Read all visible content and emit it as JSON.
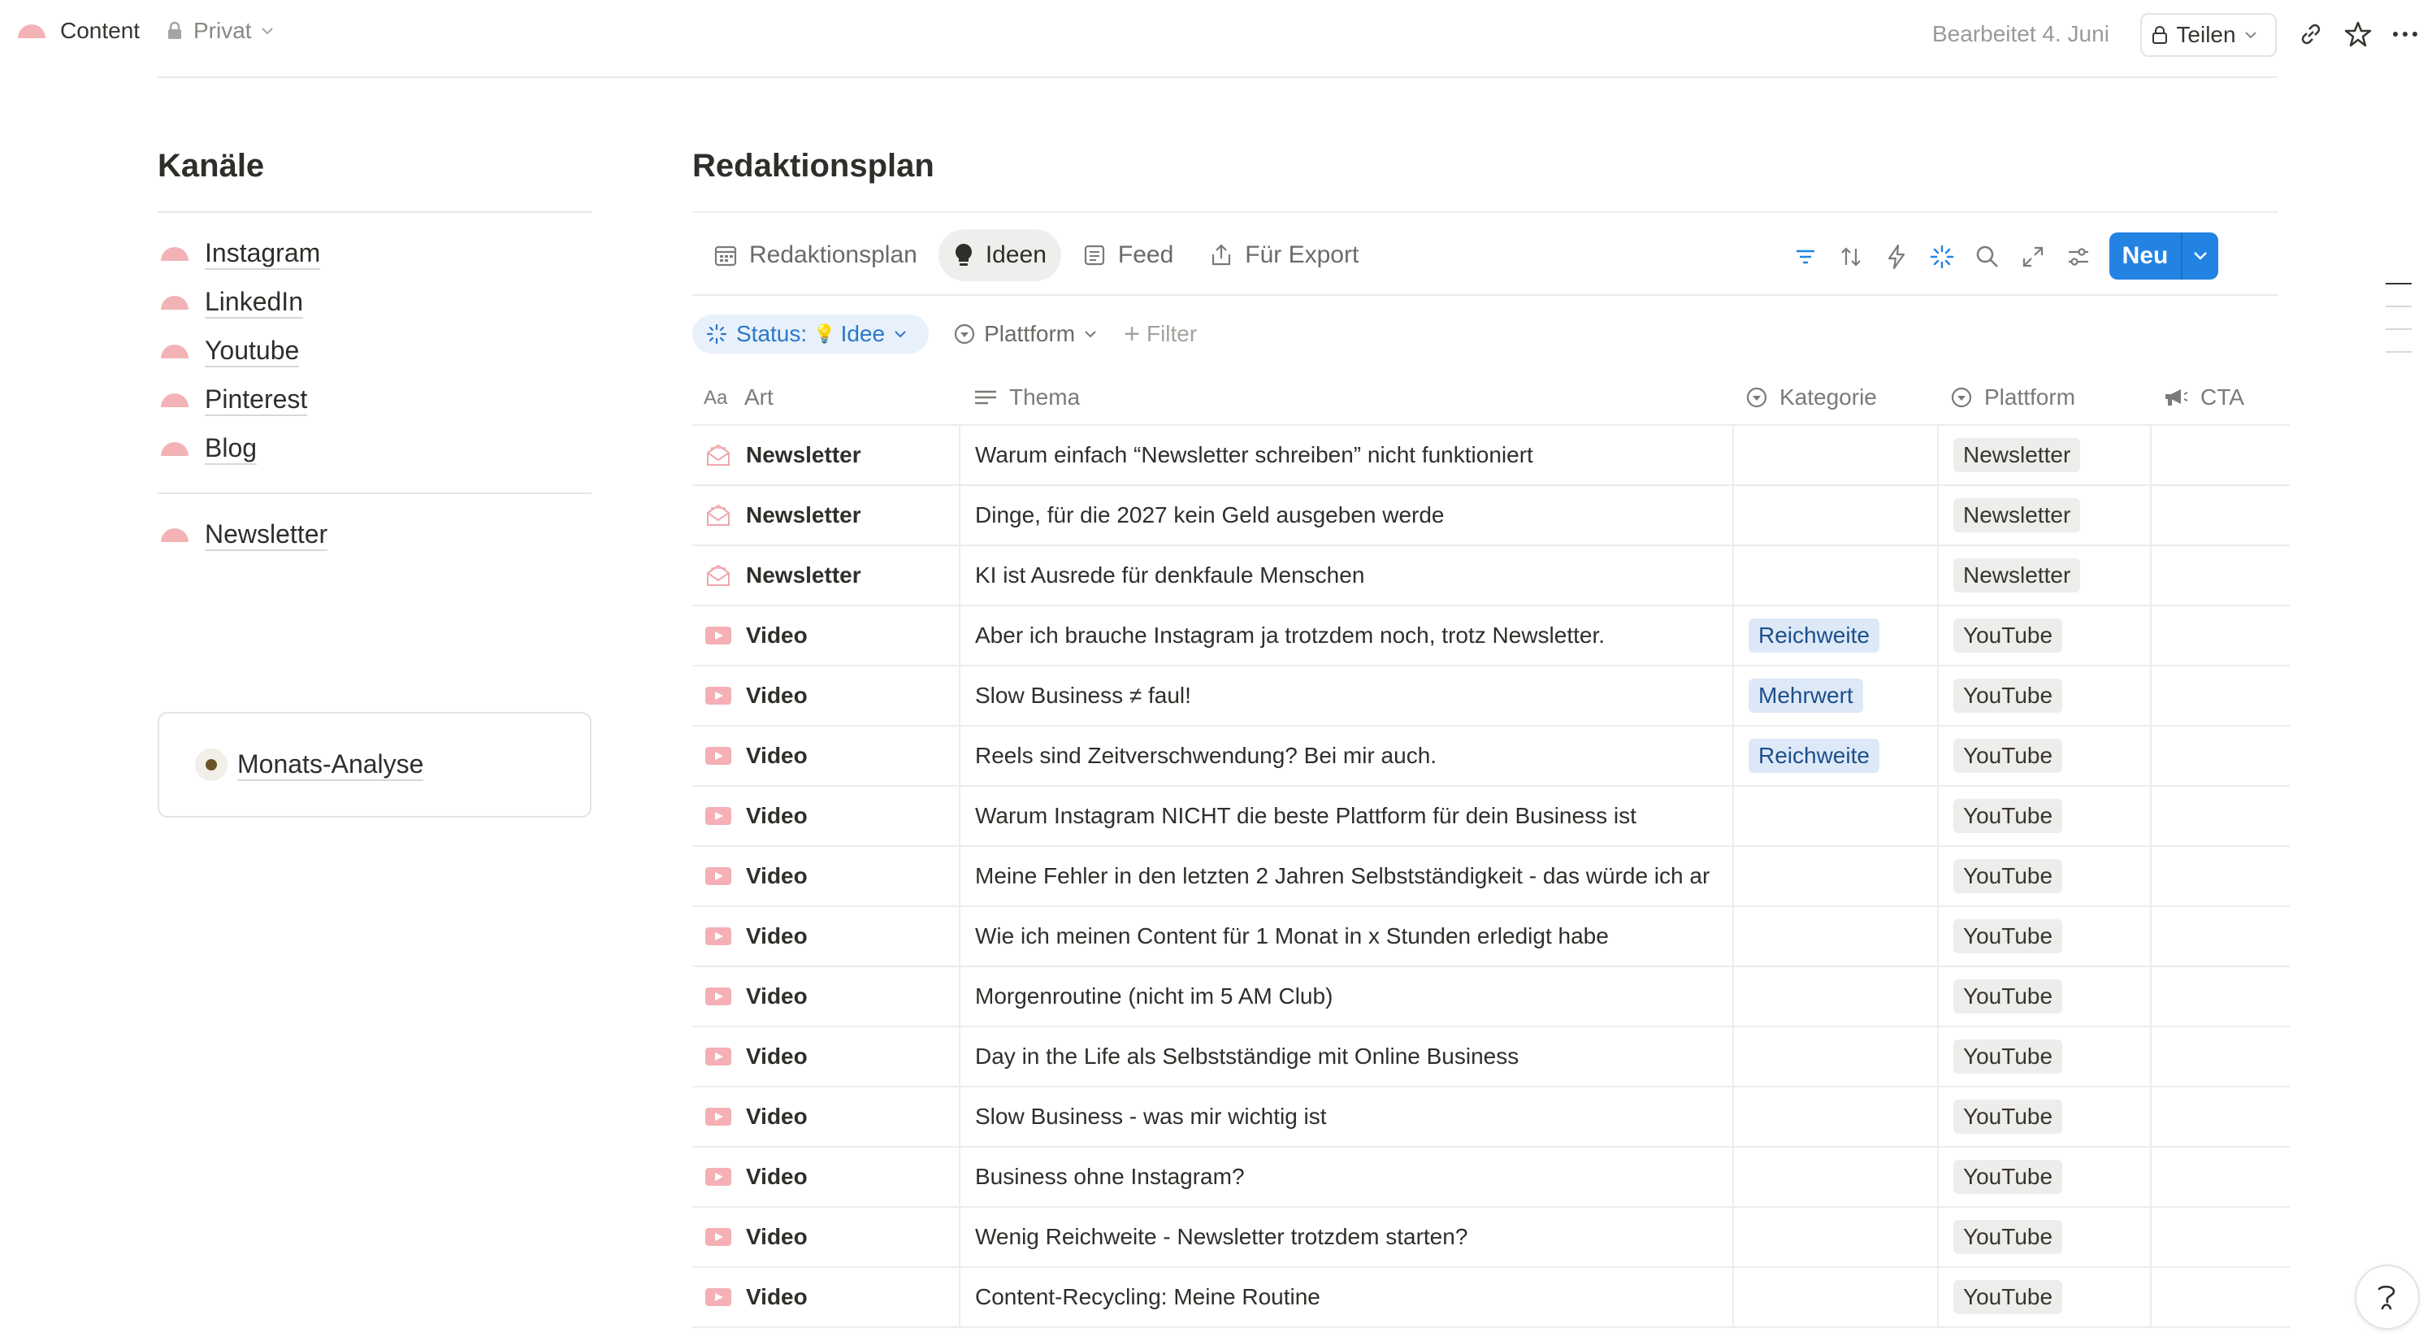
{
  "topbar": {
    "page_name": "Content",
    "visibility": "Privat",
    "edited": "Bearbeitet 4. Juni",
    "share_label": "Teilen"
  },
  "left": {
    "title": "Kanäle",
    "channels": [
      "Instagram",
      "LinkedIn",
      "Youtube",
      "Pinterest",
      "Blog"
    ],
    "extra_channel": "Newsletter",
    "callout": "Monats-Analyse"
  },
  "db": {
    "title": "Redaktionsplan",
    "views": [
      "Redaktionsplan",
      "Ideen",
      "Feed",
      "Für Export"
    ],
    "active_view": "Ideen",
    "new_label": "Neu",
    "filters": {
      "status_label": "Status:",
      "status_emoji": "💡",
      "status_value": "Idee",
      "platform_label": "Plattform",
      "add_label": "Filter"
    },
    "columns": {
      "art": "Art",
      "thema": "Thema",
      "kategorie": "Kategorie",
      "plattform": "Plattform",
      "cta": "CTA"
    },
    "rows": [
      {
        "art": "Newsletter",
        "icon": "envelope-icon",
        "thema": "Warum einfach “Newsletter schreiben” nicht funktioniert",
        "kategorie": "",
        "plattform": "Newsletter"
      },
      {
        "art": "Newsletter",
        "icon": "envelope-icon",
        "thema": "Dinge, für die 2027 kein Geld ausgeben werde",
        "kategorie": "",
        "plattform": "Newsletter"
      },
      {
        "art": "Newsletter",
        "icon": "envelope-icon",
        "thema": "KI ist Ausrede für denkfaule Menschen",
        "kategorie": "",
        "plattform": "Newsletter"
      },
      {
        "art": "Video",
        "icon": "video-icon",
        "thema": "Aber ich brauche Instagram ja trotzdem noch, trotz Newsletter.",
        "kategorie": "Reichweite",
        "plattform": "YouTube"
      },
      {
        "art": "Video",
        "icon": "video-icon",
        "thema": "Slow Business ≠ faul!",
        "kategorie": "Mehrwert",
        "plattform": "YouTube"
      },
      {
        "art": "Video",
        "icon": "video-icon",
        "thema": "Reels sind Zeitverschwendung? Bei mir auch.",
        "kategorie": "Reichweite",
        "plattform": "YouTube"
      },
      {
        "art": "Video",
        "icon": "video-icon",
        "thema": "Warum Instagram NICHT die beste Plattform für dein Business ist",
        "kategorie": "",
        "plattform": "YouTube"
      },
      {
        "art": "Video",
        "icon": "video-icon",
        "thema": "Meine Fehler in den letzten 2 Jahren Selbstständigkeit - das würde ich ar",
        "kategorie": "",
        "plattform": "YouTube"
      },
      {
        "art": "Video",
        "icon": "video-icon",
        "thema": "Wie ich meinen Content für 1 Monat in x Stunden erledigt habe",
        "kategorie": "",
        "plattform": "YouTube"
      },
      {
        "art": "Video",
        "icon": "video-icon",
        "thema": "Morgenroutine (nicht im 5 AM Club)",
        "kategorie": "",
        "plattform": "YouTube"
      },
      {
        "art": "Video",
        "icon": "video-icon",
        "thema": "Day in the Life als Selbstständige mit Online Business",
        "kategorie": "",
        "plattform": "YouTube"
      },
      {
        "art": "Video",
        "icon": "video-icon",
        "thema": "Slow Business - was mir wichtig ist",
        "kategorie": "",
        "plattform": "YouTube"
      },
      {
        "art": "Video",
        "icon": "video-icon",
        "thema": "Business ohne Instagram?",
        "kategorie": "",
        "plattform": "YouTube"
      },
      {
        "art": "Video",
        "icon": "video-icon",
        "thema": "Wenig Reichweite - Newsletter trotzdem starten?",
        "kategorie": "",
        "plattform": "YouTube"
      },
      {
        "art": "Video",
        "icon": "video-icon",
        "thema": "Content-Recycling: Meine Routine",
        "kategorie": "",
        "plattform": "YouTube"
      }
    ]
  },
  "colors": {
    "accent": "#2383e2",
    "page_icon": "#f3b3b6",
    "tag_blue_bg": "#dde9f7",
    "tag_gray_bg": "#eeedeb"
  }
}
